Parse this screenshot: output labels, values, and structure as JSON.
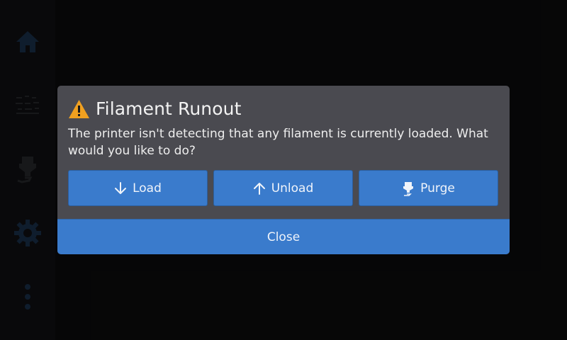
{
  "colors": {
    "background": "#0c0c0d",
    "sidebar": "#111214",
    "dialog": "#4a4a50",
    "accent": "#3a7bcc",
    "warning": "#f0a020",
    "icon_dim": "#1d3552"
  },
  "sidebar": {
    "items": [
      {
        "icon": "home-icon"
      },
      {
        "icon": "bed-mesh-icon"
      },
      {
        "icon": "filament-extruder-icon"
      },
      {
        "icon": "gear-icon"
      },
      {
        "icon": "more-vertical-icon"
      }
    ]
  },
  "dialog": {
    "icon": "warning-icon",
    "title": "Filament Runout",
    "message": "The printer isn't detecting that any filament is currently loaded. What would you like to do?",
    "actions": [
      {
        "label": "Load",
        "icon": "arrow-down-icon"
      },
      {
        "label": "Unload",
        "icon": "arrow-up-icon"
      },
      {
        "label": "Purge",
        "icon": "extruder-purge-icon"
      }
    ],
    "close_label": "Close"
  }
}
